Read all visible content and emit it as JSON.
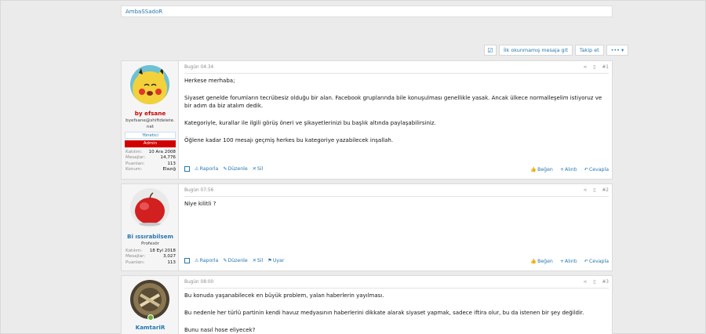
{
  "breadcrumb": {
    "forum": "AmbaSSadoR"
  },
  "actions": {
    "first_unread": "İlk okunmamış mesaja git",
    "follow": "Takip et",
    "more": "••• ▾"
  },
  "posts": [
    {
      "date": "Bugün 04:34",
      "number": "#1",
      "username": "by efsane",
      "user_title": "byefsane@shiftdelete.net",
      "badges": [
        "Yönetici",
        "Admin"
      ],
      "stats": [
        {
          "k": "Katılım:",
          "v": "10 Ara 2008"
        },
        {
          "k": "Mesajlar:",
          "v": "14,776"
        },
        {
          "k": "Puanları:",
          "v": "113"
        },
        {
          "k": "Konum:",
          "v": "Elazığ"
        }
      ],
      "body": [
        "Herkese merhaba;",
        "Siyaset genelde forumların tecrübesiz olduğu bir alan. Facebook gruplarında bile konuşulması genellikle yasak. Ancak ülkece normalleşelim istiyoruz ve bir adım da biz atalım dedik.",
        "Kategoriyle, kurallar ile ilgili görüş öneri ve şikayetlerinizi bu başlık altında paylaşabilirsiniz.",
        "Öğlene kadar 100 mesajı geçmiş herkes bu kategoriye yazabilecek inşallah."
      ],
      "foot_left": [
        "Raporla",
        "Düzenle",
        "Sil"
      ],
      "foot_right": [
        "Beğen",
        "Alıntı",
        "Cevapla"
      ]
    },
    {
      "date": "Bugün 07:56",
      "number": "#2",
      "username": "Bi ıssırabilsem",
      "user_title": "Profesör",
      "stats": [
        {
          "k": "Katılım:",
          "v": "18 Eyl 2018"
        },
        {
          "k": "Mesajlar:",
          "v": "3,027"
        },
        {
          "k": "Puanları:",
          "v": "113"
        }
      ],
      "body": [
        "Niye kilitli ?"
      ],
      "foot_left": [
        "Raporla",
        "Düzenle",
        "Sil",
        "Uyar"
      ],
      "foot_right": [
        "Beğen",
        "Alıntı",
        "Cevapla"
      ]
    },
    {
      "date": "Bugün 08:00",
      "number": "#3",
      "username": "KamtariR",
      "body": [
        "Bu konuda yaşanabilecek en büyük problem, yalan haberlerin yayılması.",
        "Bu nedenle her türlü partinin kendi havuz medyasının haberlerini dikkate alarak siyaset yapmak, sadece iftira olur, bu da istenen bir şey değildir.",
        "Bunu nasıl hose eliyecek?"
      ]
    }
  ],
  "colors": {
    "link": "#2577b1",
    "admin_badge": "#d20000",
    "username_red": "#c40000"
  }
}
